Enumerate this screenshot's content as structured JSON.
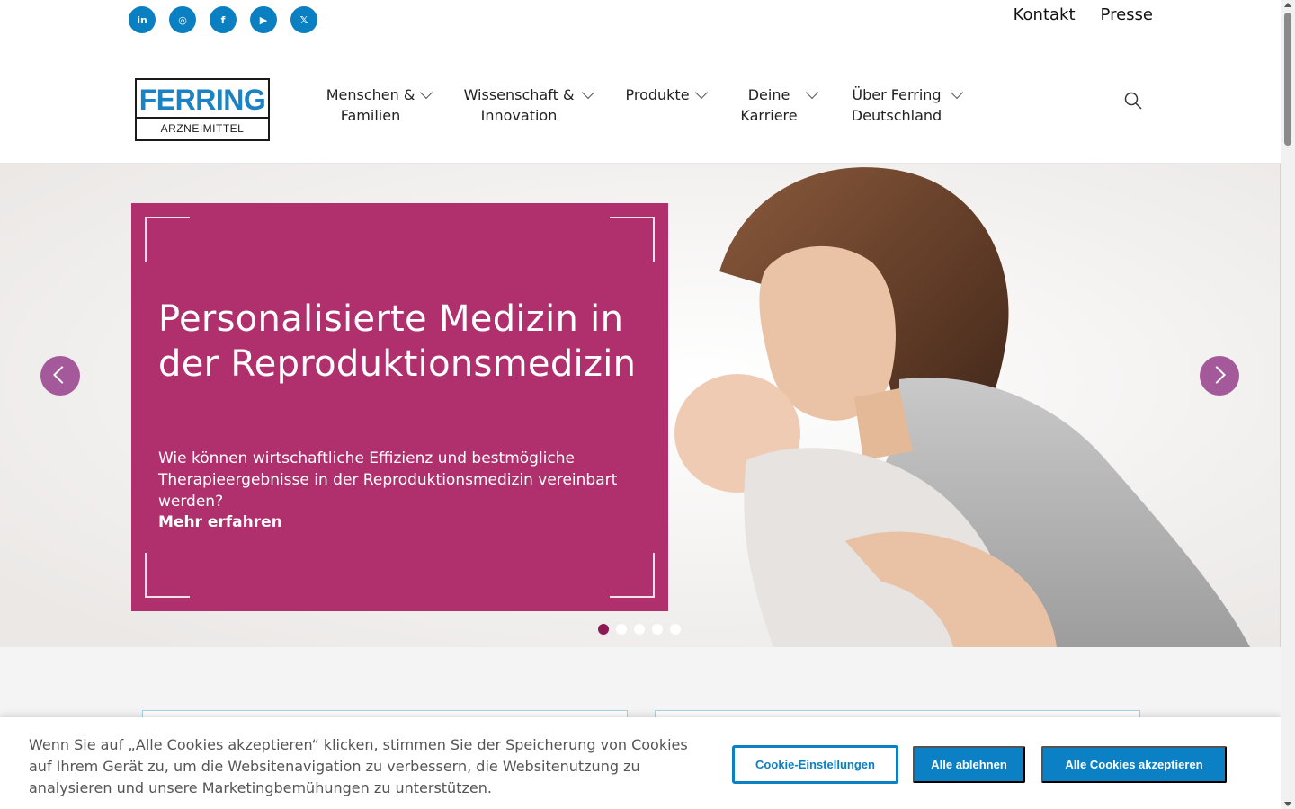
{
  "social": [
    {
      "name": "linkedin-icon",
      "glyph": "in"
    },
    {
      "name": "instagram-icon",
      "glyph": "◎"
    },
    {
      "name": "facebook-icon",
      "glyph": "f"
    },
    {
      "name": "youtube-icon",
      "glyph": "▶"
    },
    {
      "name": "x-icon",
      "glyph": "𝕏"
    }
  ],
  "toplinks": {
    "contact": "Kontakt",
    "press": "Presse"
  },
  "logo": {
    "brand": "FERRING",
    "sub": "ARZNEIMITTEL"
  },
  "nav": [
    {
      "line1": "Menschen &",
      "line2": "Familien"
    },
    {
      "line1": "Wissenschaft &",
      "line2": "Innovation"
    },
    {
      "line1": "Produkte",
      "line2": ""
    },
    {
      "line1": "Deine",
      "line2": "Karriere"
    },
    {
      "line1": "Über Ferring",
      "line2": "Deutschland"
    }
  ],
  "hero": {
    "title": "Personalisierte Medizin in der Reproduktionsmedizin",
    "text": "Wie können wirtschaftliche Effizienz und bestmögliche Therapieergebnisse in der Reproduktionsmedizin vereinbart werden?",
    "link": "Mehr erfahren",
    "slide_count": 5,
    "active_slide": 1
  },
  "cookie": {
    "text": "Wenn Sie auf „Alle Cookies akzeptieren“ klicken, stimmen Sie der Speicherung von Cookies auf Ihrem Gerät zu, um die Websitenavigation zu verbessern, die Websitenutzung zu analysieren und unsere Marketingbemühungen zu unterstützen.",
    "settings": "Cookie-Einstellungen",
    "reject": "Alle ablehnen",
    "accept": "Alle Cookies akzeptieren"
  },
  "colors": {
    "brand_blue": "#0b80c5",
    "panel": "#b0306e",
    "arrow": "#a45a9a"
  }
}
